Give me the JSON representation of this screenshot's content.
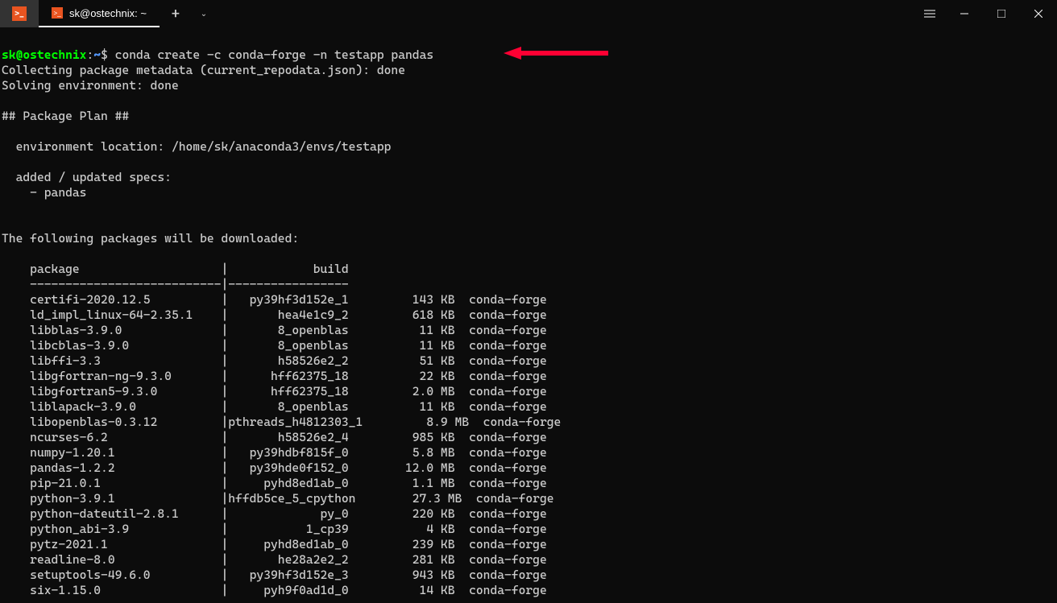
{
  "titlebar": {
    "tab_title": "sk@ostechnix: ~",
    "add_button": "+",
    "dropdown": "⌄"
  },
  "prompt": {
    "user": "sk@ostechnix",
    "separator": ":",
    "path": "~",
    "symbol": "$",
    "command": "conda create -c conda-forge -n testapp pandas"
  },
  "output": {
    "line1": "Collecting package metadata (current_repodata.json): done",
    "line2": "Solving environment: done",
    "section_header": "## Package Plan ##",
    "env_location": "  environment location: /home/sk/anaconda3/envs/testapp",
    "added_specs": "  added / updated specs:",
    "spec_item": "    - pandas",
    "download_header": "The following packages will be downloaded:",
    "col_package": "    package                    |            build",
    "col_divider": "    ---------------------------|-----------------",
    "packages": [
      "    certifi-2020.12.5          |   py39hf3d152e_1         143 KB  conda-forge",
      "    ld_impl_linux-64-2.35.1    |       hea4e1c9_2         618 KB  conda-forge",
      "    libblas-3.9.0              |       8_openblas          11 KB  conda-forge",
      "    libcblas-3.9.0             |       8_openblas          11 KB  conda-forge",
      "    libffi-3.3                 |       h58526e2_2          51 KB  conda-forge",
      "    libgfortran-ng-9.3.0       |      hff62375_18          22 KB  conda-forge",
      "    libgfortran5-9.3.0         |      hff62375_18         2.0 MB  conda-forge",
      "    liblapack-3.9.0            |       8_openblas          11 KB  conda-forge",
      "    libopenblas-0.3.12         |pthreads_h4812303_1         8.9 MB  conda-forge",
      "    ncurses-6.2                |       h58526e2_4         985 KB  conda-forge",
      "    numpy-1.20.1               |   py39hdbf815f_0         5.8 MB  conda-forge",
      "    pandas-1.2.2               |   py39hde0f152_0        12.0 MB  conda-forge",
      "    pip-21.0.1                 |     pyhd8ed1ab_0         1.1 MB  conda-forge",
      "    python-3.9.1               |hffdb5ce_5_cpython        27.3 MB  conda-forge",
      "    python-dateutil-2.8.1      |             py_0         220 KB  conda-forge",
      "    python_abi-3.9             |           1_cp39           4 KB  conda-forge",
      "    pytz-2021.1                |     pyhd8ed1ab_0         239 KB  conda-forge",
      "    readline-8.0               |       he28a2e2_2         281 KB  conda-forge",
      "    setuptools-49.6.0          |   py39hf3d152e_3         943 KB  conda-forge",
      "    six-1.15.0                 |     pyh9f0ad1d_0          14 KB  conda-forge"
    ]
  }
}
